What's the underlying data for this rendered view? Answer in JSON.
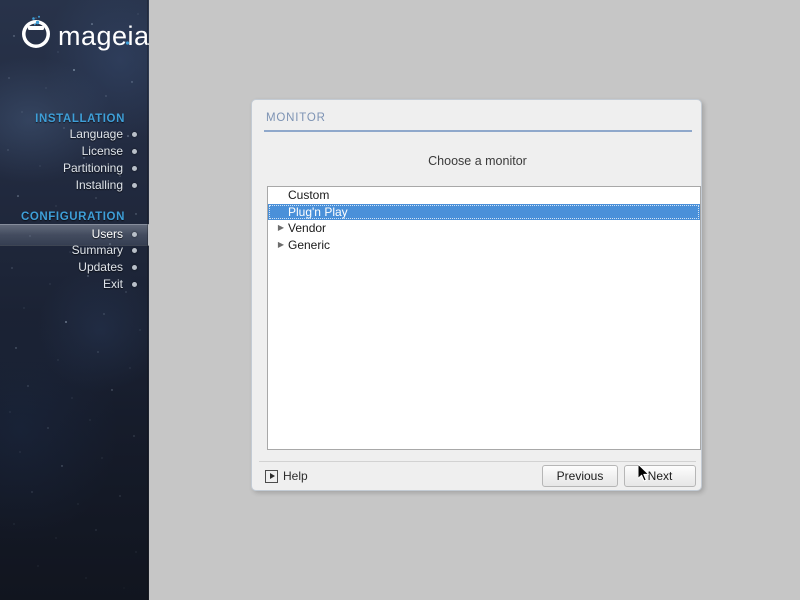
{
  "background_color": "#c6c6c6",
  "sidebar": {
    "logo_text": "mageia",
    "logo_icon": "mageia-cauldron-logo",
    "sections": [
      {
        "heading": "INSTALLATION",
        "items": [
          {
            "label": "Language",
            "current": false
          },
          {
            "label": "License",
            "current": false
          },
          {
            "label": "Partitioning",
            "current": false
          },
          {
            "label": "Installing",
            "current": false
          }
        ]
      },
      {
        "heading": "CONFIGURATION",
        "items": [
          {
            "label": "Users",
            "current": true
          },
          {
            "label": "Summary",
            "current": false
          },
          {
            "label": "Updates",
            "current": false
          },
          {
            "label": "Exit",
            "current": false
          }
        ]
      }
    ],
    "heading_color": "#3e9fd8",
    "item_color": "#dfe4ea"
  },
  "dialog": {
    "section_title": "MONITOR",
    "prompt": "Choose a monitor",
    "accent_color": "#8fa8cb",
    "selection_color": "#4a90d9",
    "list": [
      {
        "label": "Custom",
        "expandable": false,
        "selected": false
      },
      {
        "label": "Plug'n Play",
        "expandable": false,
        "selected": true
      },
      {
        "label": "Vendor",
        "expandable": true,
        "selected": false
      },
      {
        "label": "Generic",
        "expandable": true,
        "selected": false
      }
    ],
    "footer": {
      "help_label": "Help",
      "help_icon": "help-play-box-icon",
      "previous_label": "Previous",
      "next_label": "Next"
    }
  },
  "cursor": {
    "icon": "arrow-pointer-cursor",
    "over": "Next"
  }
}
